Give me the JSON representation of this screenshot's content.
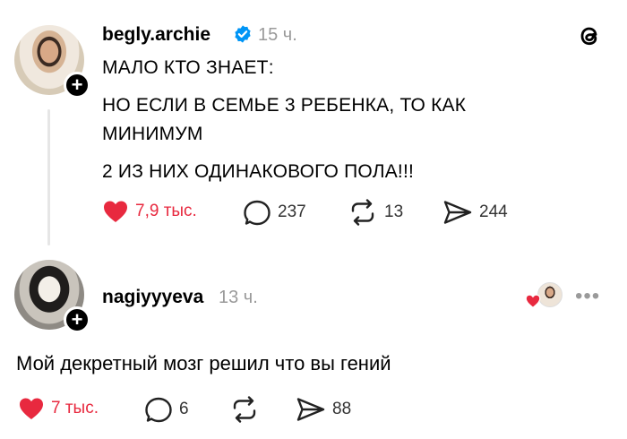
{
  "post": {
    "username": "begly.archie",
    "time": "15 ч.",
    "lines": [
      "МАЛО КТО ЗНАЕТ:",
      "НО ЕСЛИ В СЕМЬЕ 3 РЕБЕНКА, ТО КАК",
      "МИНИМУМ",
      "2 ИЗ НИХ ОДИНАКОВОГО ПОЛА!!!"
    ],
    "likes": "7,9 тыс.",
    "comments": "237",
    "reposts": "13",
    "shares": "244"
  },
  "reply": {
    "username": "nagiyyyeva",
    "time": "13 ч.",
    "text": "Мой декретный мозг решил что вы гений",
    "likes": "7 тыс.",
    "comments": "6",
    "shares": "88",
    "more": "•••"
  },
  "colors": {
    "like_red": "#e8293f",
    "verified_blue": "#0095f6",
    "muted_gray": "#9a9a9a"
  },
  "icons": [
    "threads-logo-icon",
    "verified-icon",
    "heart-icon",
    "comment-icon",
    "repost-icon",
    "share-icon",
    "plus-icon",
    "more-icon"
  ]
}
